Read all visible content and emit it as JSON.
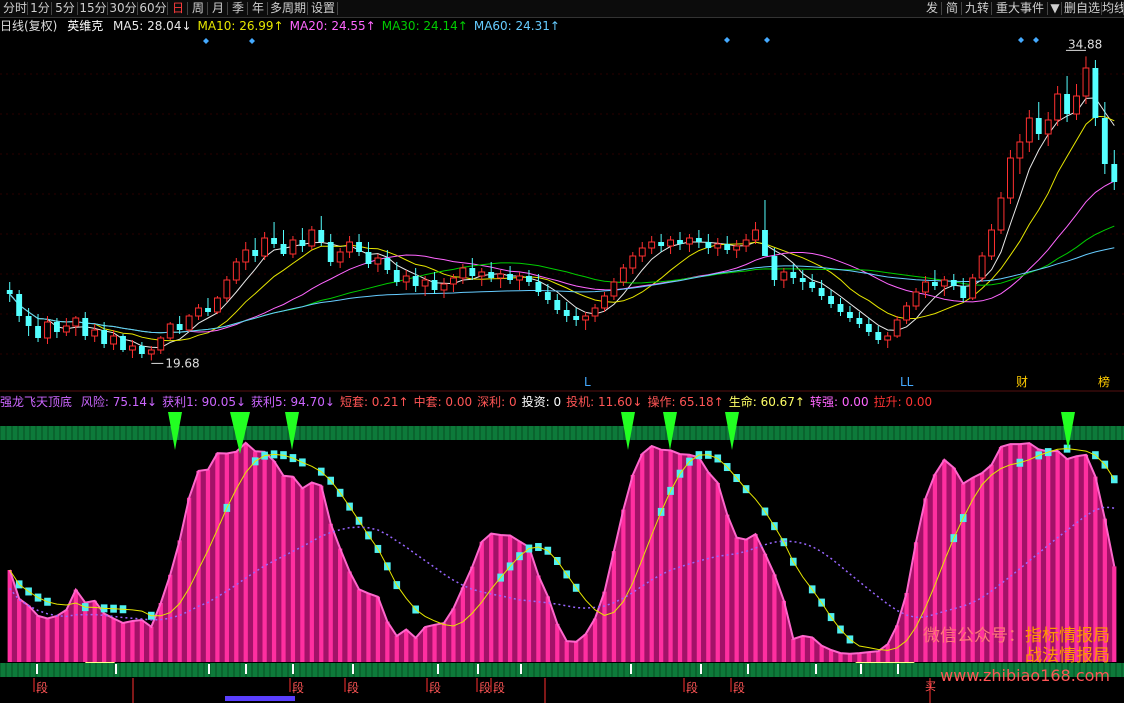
{
  "toolbar": {
    "left": [
      "分时",
      "1分",
      "5分",
      "15分",
      "30分",
      "60分",
      "日",
      "周",
      "月",
      "季",
      "年",
      "多周期",
      "设置"
    ],
    "active": "日",
    "right": [
      "发",
      "简",
      "九转",
      "重大事件",
      "▼",
      "删自选",
      "均线"
    ]
  },
  "ma_bar": {
    "chart_type": "日线(复权)",
    "stock": "英维克",
    "items": [
      {
        "label": "MA5: 28.04",
        "arrow": "↓",
        "color": "#e8e8e8"
      },
      {
        "label": "MA10: 26.99",
        "arrow": "↑",
        "color": "#e6e600"
      },
      {
        "label": "MA20: 24.55",
        "arrow": "↑",
        "color": "#ff66ff"
      },
      {
        "label": "MA30: 24.14",
        "arrow": "↑",
        "color": "#00cc00"
      },
      {
        "label": "MA60: 24.31",
        "arrow": "↑",
        "color": "#66ccff"
      }
    ]
  },
  "price_labels": {
    "high": "34.88",
    "low": "19.68"
  },
  "chart_markers": {
    "l1": "L",
    "l2": "LL",
    "cai": "财",
    "bang": "榜"
  },
  "sub_title": {
    "name": "强龙飞天顶底",
    "items": [
      {
        "label": "风险: 75.14",
        "arrow": "↓",
        "color": "#cc66ff"
      },
      {
        "label": "获利1: 90.05",
        "arrow": "↓",
        "color": "#cc66ff"
      },
      {
        "label": "获利5: 94.70",
        "arrow": "↓",
        "color": "#cc66ff"
      },
      {
        "label": "短套: 0.21",
        "arrow": "↑",
        "color": "#ff5555"
      },
      {
        "label": "中套: 0.00",
        "arrow": "",
        "color": "#ff5555"
      },
      {
        "label": "深利: 0",
        "arrow": "",
        "color": "#ff5555"
      },
      {
        "label": "投资: 0",
        "arrow": "",
        "color": "#ffffff"
      },
      {
        "label": "投机: 11.60",
        "arrow": "↓",
        "color": "#ff5555"
      },
      {
        "label": "操作: 65.18",
        "arrow": "↑",
        "color": "#ff5555"
      },
      {
        "label": "生命: 60.67",
        "arrow": "↑",
        "color": "#ffff66"
      },
      {
        "label": "转强: 0.00",
        "arrow": "",
        "color": "#ff66ff"
      },
      {
        "label": "拉升: 0.00",
        "arrow": "",
        "color": "#ff3333"
      }
    ]
  },
  "buy_marker": "买",
  "duan_marker": "段",
  "watermark": {
    "line1_prefix": "微信公众号：",
    "line1_name": "指标情报局",
    "line2_name": "战法情报局",
    "site": "www.zhibiao168.com"
  },
  "chart_data": {
    "type": "candlestick",
    "note": "daily candlestick series (open, high, low, close) plus moving averages and an oscillator sub-panel",
    "ohlc": [
      [
        23.2,
        23.6,
        22.6,
        23.0
      ],
      [
        23.0,
        23.2,
        21.6,
        21.9
      ],
      [
        21.9,
        22.3,
        20.9,
        21.4
      ],
      [
        21.4,
        22.0,
        20.6,
        20.8
      ],
      [
        20.8,
        21.9,
        20.5,
        21.6
      ],
      [
        21.6,
        21.8,
        20.8,
        21.1
      ],
      [
        21.1,
        21.8,
        20.9,
        21.4
      ],
      [
        21.4,
        21.9,
        20.9,
        21.8
      ],
      [
        21.8,
        22.1,
        20.7,
        20.9
      ],
      [
        20.9,
        21.5,
        20.6,
        21.2
      ],
      [
        21.2,
        21.6,
        20.3,
        20.5
      ],
      [
        20.5,
        21.2,
        20.2,
        20.9
      ],
      [
        20.9,
        21.0,
        20.1,
        20.2
      ],
      [
        20.2,
        20.7,
        19.8,
        20.4
      ],
      [
        20.4,
        20.6,
        19.8,
        20.0
      ],
      [
        20.0,
        20.4,
        19.68,
        20.2
      ],
      [
        20.2,
        20.9,
        20.0,
        20.8
      ],
      [
        20.8,
        21.6,
        20.7,
        21.5
      ],
      [
        21.5,
        21.9,
        21.0,
        21.2
      ],
      [
        21.2,
        22.0,
        21.1,
        21.9
      ],
      [
        21.9,
        22.5,
        21.7,
        22.3
      ],
      [
        22.3,
        22.8,
        21.9,
        22.1
      ],
      [
        22.1,
        22.9,
        22.0,
        22.8
      ],
      [
        22.8,
        23.9,
        22.6,
        23.7
      ],
      [
        23.7,
        24.8,
        23.5,
        24.6
      ],
      [
        24.6,
        25.6,
        24.2,
        25.2
      ],
      [
        25.2,
        25.8,
        24.6,
        24.9
      ],
      [
        24.9,
        26.1,
        24.7,
        25.8
      ],
      [
        25.8,
        26.6,
        25.3,
        25.5
      ],
      [
        25.5,
        26.2,
        24.9,
        25.0
      ],
      [
        25.0,
        25.9,
        24.8,
        25.7
      ],
      [
        25.7,
        26.3,
        25.1,
        25.4
      ],
      [
        25.4,
        26.4,
        25.2,
        26.2
      ],
      [
        26.2,
        26.9,
        25.4,
        25.6
      ],
      [
        25.6,
        26.0,
        24.4,
        24.6
      ],
      [
        24.6,
        25.3,
        24.3,
        25.1
      ],
      [
        25.1,
        25.9,
        24.8,
        25.6
      ],
      [
        25.6,
        26.0,
        24.9,
        25.1
      ],
      [
        25.1,
        25.6,
        24.3,
        24.5
      ],
      [
        24.5,
        25.0,
        24.1,
        24.8
      ],
      [
        24.8,
        25.2,
        24.0,
        24.2
      ],
      [
        24.2,
        24.6,
        23.4,
        23.6
      ],
      [
        23.6,
        24.2,
        23.2,
        23.9
      ],
      [
        23.9,
        24.3,
        23.1,
        23.4
      ],
      [
        23.4,
        23.9,
        22.9,
        23.7
      ],
      [
        23.7,
        24.1,
        23.0,
        23.2
      ],
      [
        23.2,
        23.8,
        22.8,
        23.5
      ],
      [
        23.5,
        24.0,
        23.1,
        23.8
      ],
      [
        23.8,
        24.5,
        23.5,
        24.3
      ],
      [
        24.3,
        24.8,
        23.7,
        23.9
      ],
      [
        23.9,
        24.3,
        23.4,
        24.1
      ],
      [
        24.1,
        24.6,
        23.6,
        23.8
      ],
      [
        23.8,
        24.2,
        23.3,
        24.0
      ],
      [
        24.0,
        24.4,
        23.5,
        23.7
      ],
      [
        23.7,
        24.1,
        23.2,
        23.9
      ],
      [
        23.9,
        24.2,
        23.4,
        23.6
      ],
      [
        23.6,
        24.0,
        22.9,
        23.1
      ],
      [
        23.1,
        23.5,
        22.5,
        22.7
      ],
      [
        22.7,
        23.0,
        22.0,
        22.2
      ],
      [
        22.2,
        22.6,
        21.6,
        21.9
      ],
      [
        21.9,
        22.3,
        21.4,
        21.7
      ],
      [
        21.7,
        22.1,
        21.2,
        21.9
      ],
      [
        21.9,
        22.5,
        21.6,
        22.3
      ],
      [
        22.3,
        23.1,
        22.1,
        22.9
      ],
      [
        22.9,
        23.8,
        22.7,
        23.6
      ],
      [
        23.6,
        24.5,
        23.4,
        24.3
      ],
      [
        24.3,
        25.1,
        24.0,
        24.9
      ],
      [
        24.9,
        25.6,
        24.6,
        25.3
      ],
      [
        25.3,
        25.9,
        25.0,
        25.6
      ],
      [
        25.6,
        26.0,
        25.1,
        25.4
      ],
      [
        25.4,
        25.9,
        25.0,
        25.7
      ],
      [
        25.7,
        26.1,
        25.2,
        25.5
      ],
      [
        25.5,
        26.0,
        25.1,
        25.8
      ],
      [
        25.8,
        26.2,
        25.3,
        25.6
      ],
      [
        25.6,
        26.0,
        25.0,
        25.3
      ],
      [
        25.3,
        25.8,
        24.9,
        25.5
      ],
      [
        25.5,
        25.9,
        25.0,
        25.2
      ],
      [
        25.2,
        25.7,
        24.8,
        25.4
      ],
      [
        25.4,
        26.0,
        25.1,
        25.7
      ],
      [
        25.7,
        26.6,
        25.5,
        26.2
      ],
      [
        26.2,
        27.7,
        25.8,
        24.9
      ],
      [
        24.9,
        25.3,
        23.4,
        23.7
      ],
      [
        23.7,
        24.3,
        23.3,
        24.1
      ],
      [
        24.1,
        24.5,
        23.5,
        23.8
      ],
      [
        23.8,
        24.2,
        23.2,
        23.6
      ],
      [
        23.6,
        24.0,
        23.1,
        23.3
      ],
      [
        23.3,
        23.7,
        22.7,
        22.9
      ],
      [
        22.9,
        23.2,
        22.3,
        22.5
      ],
      [
        22.5,
        22.8,
        21.9,
        22.1
      ],
      [
        22.1,
        22.4,
        21.6,
        21.8
      ],
      [
        21.8,
        22.1,
        21.3,
        21.5
      ],
      [
        21.5,
        21.8,
        20.9,
        21.1
      ],
      [
        21.1,
        21.4,
        20.5,
        20.7
      ],
      [
        20.7,
        21.1,
        20.3,
        20.9
      ],
      [
        20.9,
        21.9,
        20.8,
        21.7
      ],
      [
        21.7,
        22.6,
        21.5,
        22.4
      ],
      [
        22.4,
        23.3,
        22.2,
        23.1
      ],
      [
        23.1,
        23.9,
        22.8,
        23.6
      ],
      [
        23.6,
        24.2,
        23.2,
        23.4
      ],
      [
        23.4,
        23.9,
        22.9,
        23.7
      ],
      [
        23.7,
        24.0,
        23.2,
        23.4
      ],
      [
        23.4,
        23.8,
        22.6,
        22.8
      ],
      [
        22.8,
        24.0,
        22.7,
        23.8
      ],
      [
        23.8,
        25.1,
        23.6,
        24.9
      ],
      [
        24.9,
        26.5,
        24.7,
        26.2
      ],
      [
        26.2,
        28.1,
        26.0,
        27.8
      ],
      [
        27.8,
        30.2,
        27.5,
        29.8
      ],
      [
        29.8,
        31.0,
        29.0,
        30.6
      ],
      [
        30.6,
        32.2,
        30.1,
        31.8
      ],
      [
        31.8,
        32.6,
        30.7,
        31.0
      ],
      [
        31.0,
        32.1,
        30.4,
        31.7
      ],
      [
        31.7,
        33.4,
        31.4,
        33.0
      ],
      [
        33.0,
        33.9,
        31.6,
        32.0
      ],
      [
        32.0,
        33.5,
        31.7,
        32.9
      ],
      [
        32.9,
        34.88,
        32.5,
        34.3
      ],
      [
        34.3,
        34.7,
        31.4,
        31.8
      ],
      [
        31.8,
        32.6,
        29.0,
        29.5
      ],
      [
        29.5,
        30.2,
        28.2,
        28.6
      ]
    ],
    "ma_colors": [
      "#e8e8e8",
      "#e6e600",
      "#ff66ff",
      "#00cc00",
      "#66ccff"
    ],
    "y_range": [
      19.0,
      35.5
    ]
  }
}
